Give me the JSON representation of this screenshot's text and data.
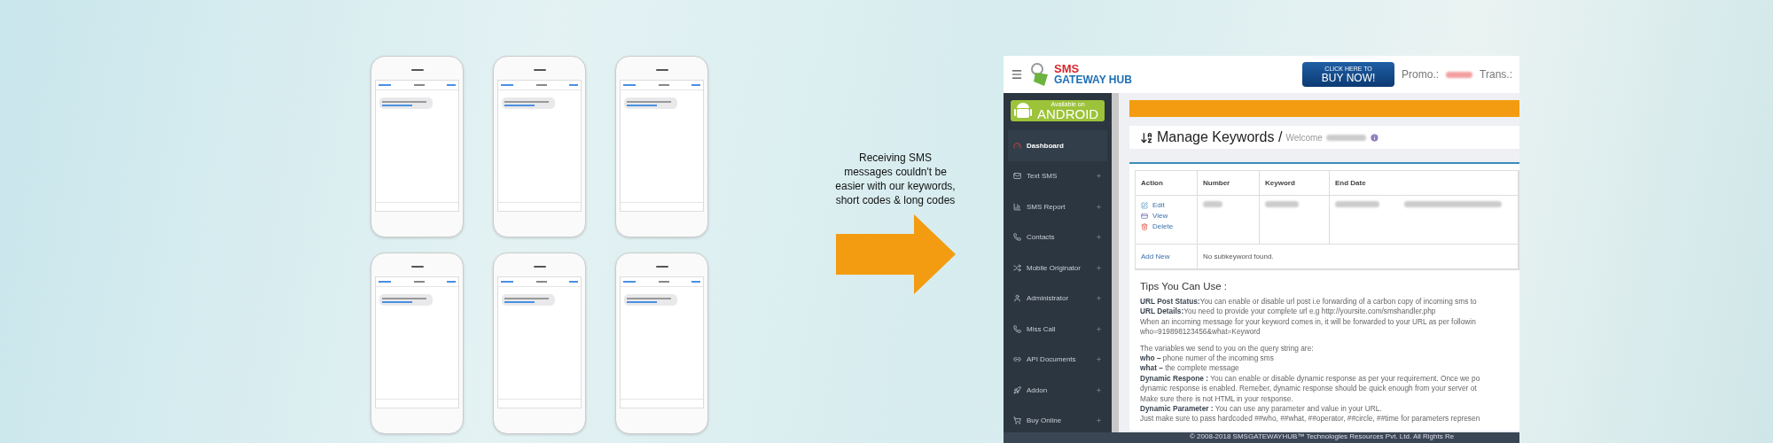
{
  "phones": [
    {
      "kind": "message-thread"
    },
    {
      "kind": "message-thread"
    },
    {
      "kind": "message-thread"
    },
    {
      "kind": "message-thread"
    },
    {
      "kind": "message-thread"
    },
    {
      "kind": "message-thread"
    }
  ],
  "caption": "Receiving SMS messages couldn't be easier with our keywords, short codes & long codes",
  "dashboard": {
    "logo": {
      "top": "SMS",
      "bottom": "GATEWAY HUB"
    },
    "buy_button": {
      "small": "CLICK HERE TO",
      "big": "BUY NOW!"
    },
    "balances": [
      {
        "label": "Promo.:",
        "redacted": true
      },
      {
        "label": "Trans.:",
        "redacted": false
      }
    ],
    "android_badge": {
      "small": "Available on",
      "big": "ANDROID"
    },
    "sidebar": {
      "items": [
        {
          "label": "Dashboard",
          "selected": true,
          "expandable": false
        },
        {
          "label": "Text SMS",
          "selected": false,
          "expandable": true
        },
        {
          "label": "SMS Report",
          "selected": false,
          "expandable": true
        },
        {
          "label": "Contacts",
          "selected": false,
          "expandable": true
        },
        {
          "label": "Mobile Originator",
          "selected": false,
          "expandable": true
        },
        {
          "label": "Administrator",
          "selected": false,
          "expandable": true
        },
        {
          "label": "Miss Call",
          "selected": false,
          "expandable": true
        },
        {
          "label": "API Documents",
          "selected": false,
          "expandable": true
        },
        {
          "label": "Addon",
          "selected": false,
          "expandable": true
        },
        {
          "label": "Buy Online",
          "selected": false,
          "expandable": true
        }
      ]
    },
    "page_title": "Manage Keywords /",
    "welcome": "Welcome",
    "table": {
      "columns": [
        "Action",
        "Number",
        "Keyword",
        "End Date"
      ],
      "actions": [
        "Edit",
        "View",
        "Delete"
      ],
      "add_new": "Add New",
      "empty_message": "No subkeyword found."
    },
    "tips_title": "Tips You Can Use :",
    "tips": [
      [
        "**URL Post Status:**You can enable or disable url post i.e forwarding of a carbon copy of incoming sms to",
        "**URL Details:**You need to provide your complete url e.g http://yoursite.com/smshandler.php",
        "When an incoming message for your keyword comes in, it will be forwarded to your URL as per followin",
        "who=919898123456&what=Keyword"
      ],
      [
        "The variables we send to you on the query string are:",
        "**who –** phone numer of the incoming sms",
        "**what –** the complete message",
        "**Dynamic Respone :** You can enable or disable dynamic response as per your requirement. Once we po",
        "dynamic response is enabled. Remeber, dynamic response should be quick enough from your server ot",
        "Make sure there is not HTML in your response.",
        "**Dynamic Parameter :** You can use any parameter and value in your URL.",
        "Just make sure to pass hardcoded ##who, ##what, ##operator, ##circle, ##time for parameters represen"
      ]
    ],
    "footer": "© 2008-2018 SMSGATEWAYHUB™ Technologies Resources Pvt. Ltd. All Rights Re"
  }
}
